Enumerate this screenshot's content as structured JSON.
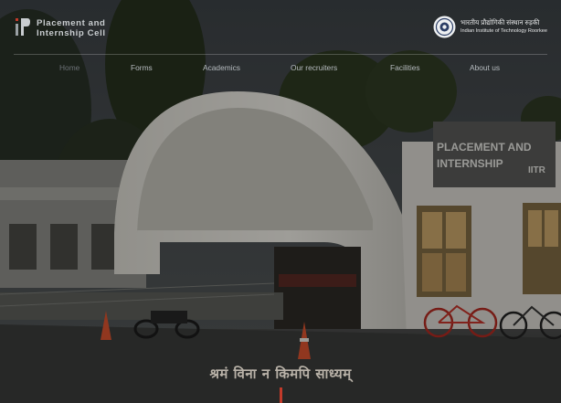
{
  "brand": {
    "line1": "Placement and",
    "line2": "Internship Cell"
  },
  "institute": {
    "hindi": "भारतीय प्रौद्योगिकी संस्थान रुड़की",
    "english": "Indian Institute of Technology Roorkee"
  },
  "nav": {
    "items": [
      {
        "label": "Home"
      },
      {
        "label": "Forms"
      },
      {
        "label": "Academics"
      },
      {
        "label": "Our recruiters"
      },
      {
        "label": "Facilities"
      },
      {
        "label": "About us"
      }
    ]
  },
  "hero": {
    "sign_line1": "PLACEMENT AND",
    "sign_line2": "INTERNSHIP",
    "sign_logo": "IITR",
    "motto": "श्रमं विना न किमपि साध्यम्"
  },
  "colors": {
    "accent_bar": "#c23a2a",
    "nav_active": "#6c7176",
    "nav_text": "#b6bbbf"
  }
}
